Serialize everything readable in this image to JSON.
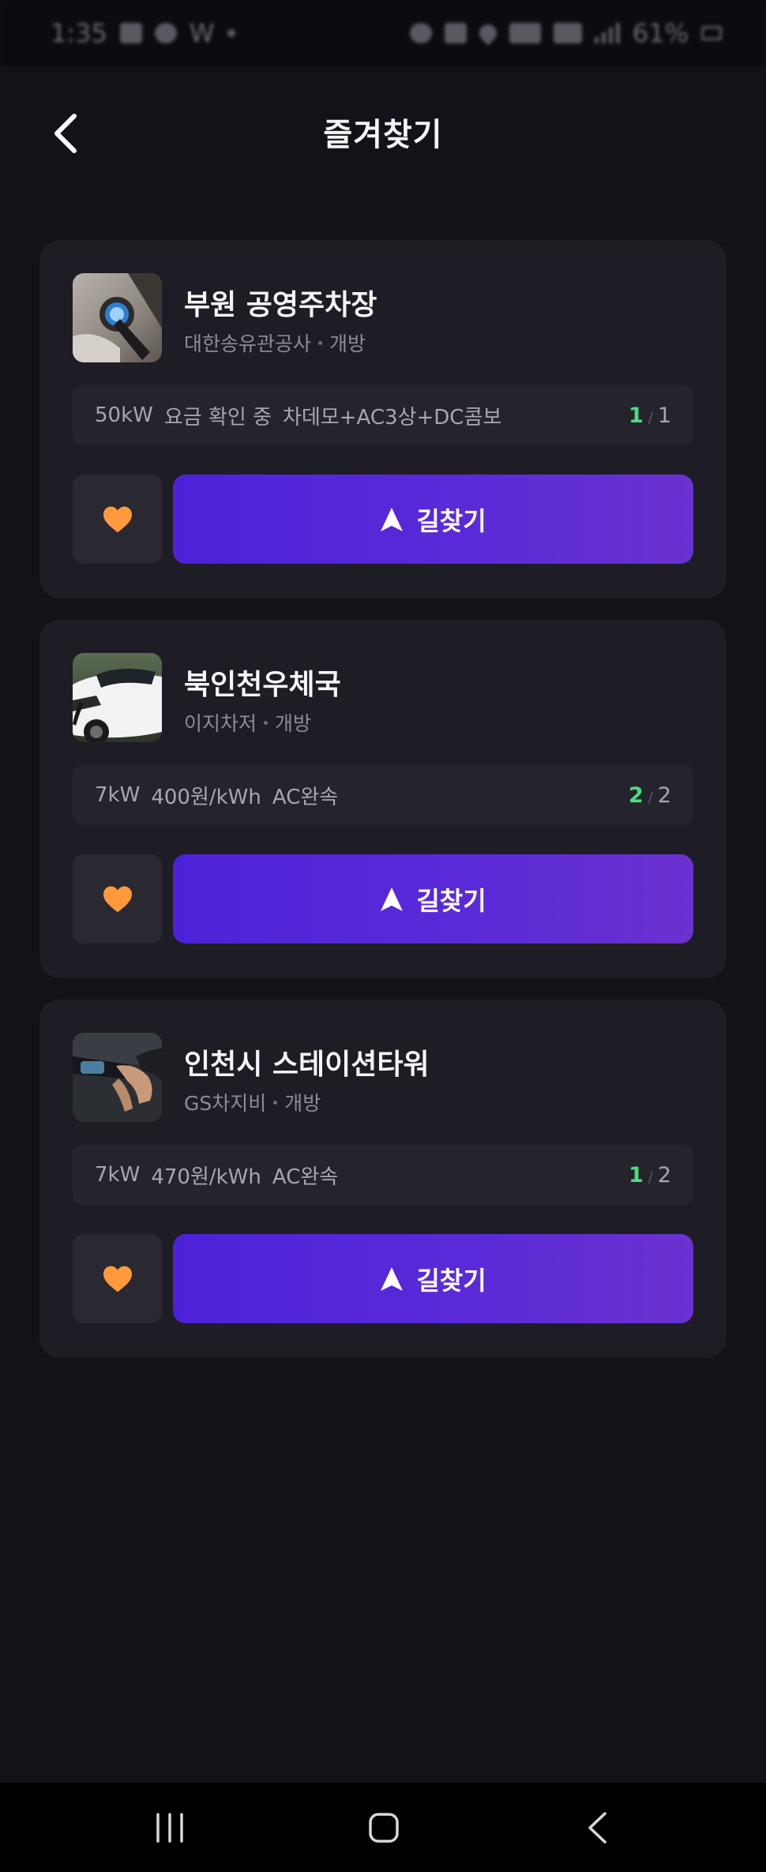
{
  "status_bar": {
    "time": "1:35",
    "app_badge": "W",
    "battery": "61%"
  },
  "header": {
    "title": "즐겨찾기"
  },
  "stations": [
    {
      "name": "부원 공영주차장",
      "operator": "대한송유관공사",
      "access": "개방",
      "power": "50kW",
      "price": "요금 확인 중",
      "connector": "차데모+AC3상+DC콤보",
      "available": "1",
      "total": "1",
      "nav_label": "길찾기"
    },
    {
      "name": "북인천우체국",
      "operator": "이지차저",
      "access": "개방",
      "power": "7kW",
      "price": "400원/kWh",
      "connector": "AC완속",
      "available": "2",
      "total": "2",
      "nav_label": "길찾기"
    },
    {
      "name": "인천시 스테이션타워",
      "operator": "GS차지비",
      "access": "개방",
      "power": "7kW",
      "price": "470원/kWh",
      "connector": "AC완속",
      "available": "1",
      "total": "2",
      "nav_label": "길찾기"
    }
  ],
  "colors": {
    "background": "#131218",
    "card": "#1e1c24",
    "accent_start": "#4c22d8",
    "accent_end": "#6a32cf",
    "available": "#4ade80",
    "heart": "#ff9a3c"
  },
  "icons": {
    "back": "chevron-left-icon",
    "favorite": "heart-icon",
    "navigate": "navigation-arrow-icon",
    "recents": "recent-apps-icon",
    "home": "home-icon",
    "system_back": "system-back-icon"
  }
}
